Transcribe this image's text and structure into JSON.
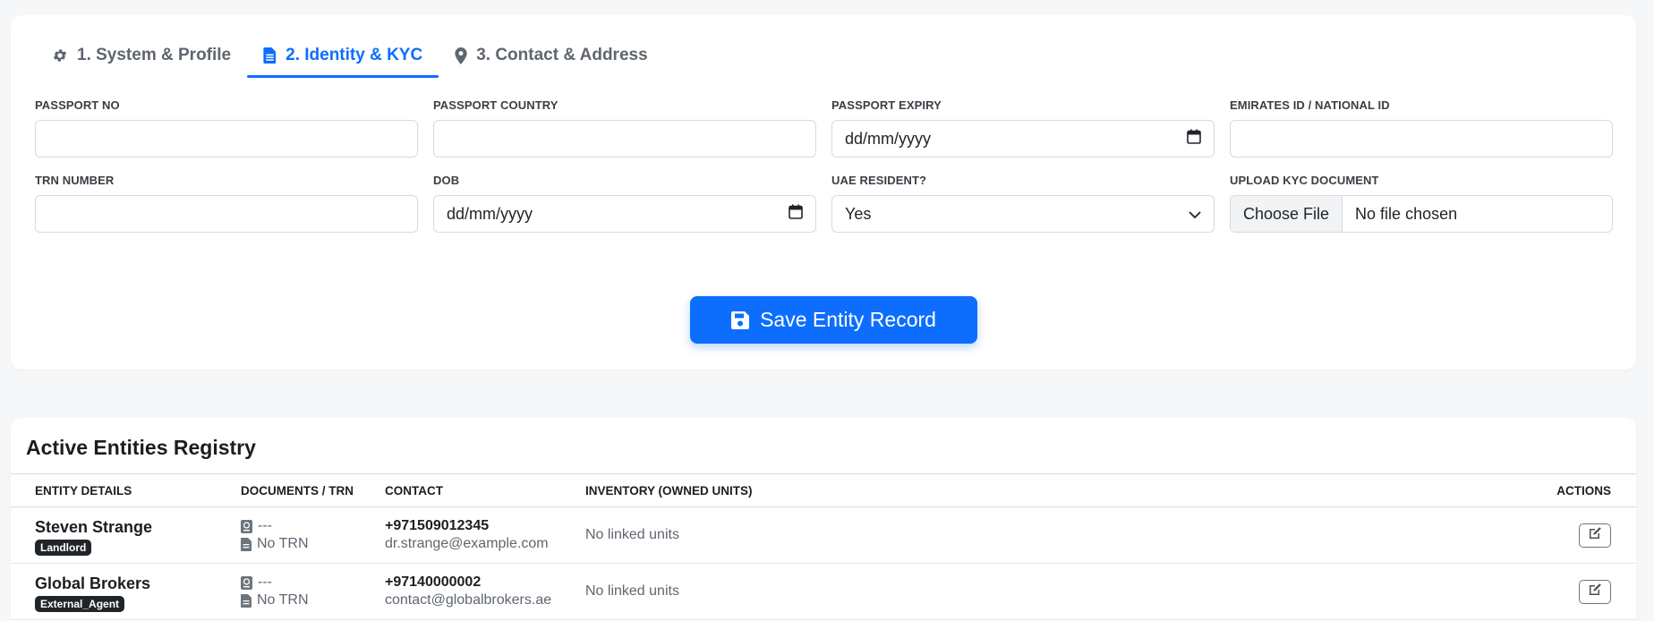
{
  "tabs": [
    {
      "label": "1. System & Profile",
      "icon": "gear-icon"
    },
    {
      "label": "2. Identity & KYC",
      "icon": "document-icon"
    },
    {
      "label": "3. Contact & Address",
      "icon": "map-pin-icon"
    }
  ],
  "active_tab": 1,
  "fields": {
    "passport_no": {
      "label": "PASSPORT NO",
      "value": ""
    },
    "passport_country": {
      "label": "PASSPORT COUNTRY",
      "value": ""
    },
    "passport_expiry": {
      "label": "PASSPORT EXPIRY",
      "value": "dd/mm/yyyy"
    },
    "emirates_id": {
      "label": "EMIRATES ID / NATIONAL ID",
      "value": ""
    },
    "trn_number": {
      "label": "TRN NUMBER",
      "value": ""
    },
    "dob": {
      "label": "DOB",
      "value": "dd/mm/yyyy"
    },
    "uae_resident": {
      "label": "UAE RESIDENT?",
      "value": "Yes"
    },
    "kyc_upload": {
      "label": "UPLOAD KYC DOCUMENT",
      "button": "Choose File",
      "status": "No file chosen"
    }
  },
  "save_button": {
    "label": "Save Entity Record"
  },
  "registry": {
    "title": "Active Entities Registry",
    "columns": [
      "ENTITY DETAILS",
      "DOCUMENTS / TRN",
      "CONTACT",
      "INVENTORY (OWNED UNITS)",
      "ACTIONS"
    ],
    "rows": [
      {
        "name": "Steven Strange",
        "badge": "Landlord",
        "passport": "---",
        "trn": "No TRN",
        "phone": "+971509012345",
        "email": "dr.strange@example.com",
        "inventory": "No linked units"
      },
      {
        "name": "Global Brokers",
        "badge": "External_Agent",
        "passport": "---",
        "trn": "No TRN",
        "phone": "+97140000002",
        "email": "contact@globalbrokers.ae",
        "inventory": "No linked units"
      }
    ]
  },
  "colors": {
    "accent": "#0d6efd",
    "badge_bg": "#212529",
    "page_bg": "#f6f7f9"
  }
}
